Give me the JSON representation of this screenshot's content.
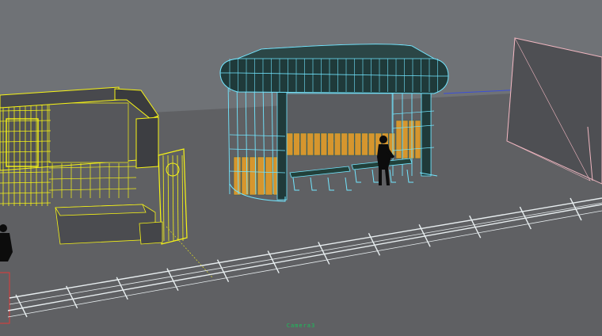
{
  "viewport": {
    "camera_label": "Camera3",
    "colors": {
      "sky": "#6f7276",
      "ground": "#5f6063",
      "selected_wireframe": "#f7f416",
      "shelter_wireframe": "#72e6ff",
      "rail_wireframe": "#e8eef0",
      "wall_wireframe": "#f0b6c0",
      "glass_panel": "#d6962e",
      "horizon_line": "#3b4fd9",
      "camera_label": "#19c05a"
    }
  }
}
